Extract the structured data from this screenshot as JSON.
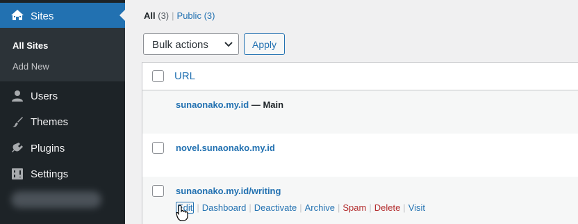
{
  "sidebar": {
    "current_menu": {
      "label": "Sites",
      "icon": "sites-home-icon"
    },
    "submenu": [
      {
        "label": "All Sites",
        "active": true
      },
      {
        "label": "Add New",
        "active": false
      }
    ],
    "items": [
      {
        "label": "Users",
        "icon": "users-icon"
      },
      {
        "label": "Themes",
        "icon": "themes-brush-icon"
      },
      {
        "label": "Plugins",
        "icon": "plugins-icon"
      },
      {
        "label": "Settings",
        "icon": "settings-icon"
      }
    ],
    "colors": {
      "bg": "#1d2327",
      "active": "#2271b1",
      "submenu_bg": "#2c3338"
    }
  },
  "filters": {
    "all_label": "All",
    "all_count": "(3)",
    "separator": "|",
    "public_label": "Public",
    "public_count": "(3)"
  },
  "bulk": {
    "selected": "Bulk actions",
    "apply_label": "Apply"
  },
  "table": {
    "column_header": "URL",
    "rows": [
      {
        "url": "sunaonako.my.id",
        "suffix": " — Main",
        "has_checkbox": false
      },
      {
        "url": "novel.sunaonako.my.id",
        "suffix": "",
        "has_checkbox": true
      },
      {
        "url": "sunaonako.my.id/writing",
        "suffix": "",
        "has_checkbox": true,
        "actions": [
          "Edit",
          "Dashboard",
          "Deactivate",
          "Archive",
          "Spam",
          "Delete",
          "Visit"
        ]
      }
    ]
  },
  "colors": {
    "link": "#2271b1",
    "delete": "#b32d2e"
  }
}
